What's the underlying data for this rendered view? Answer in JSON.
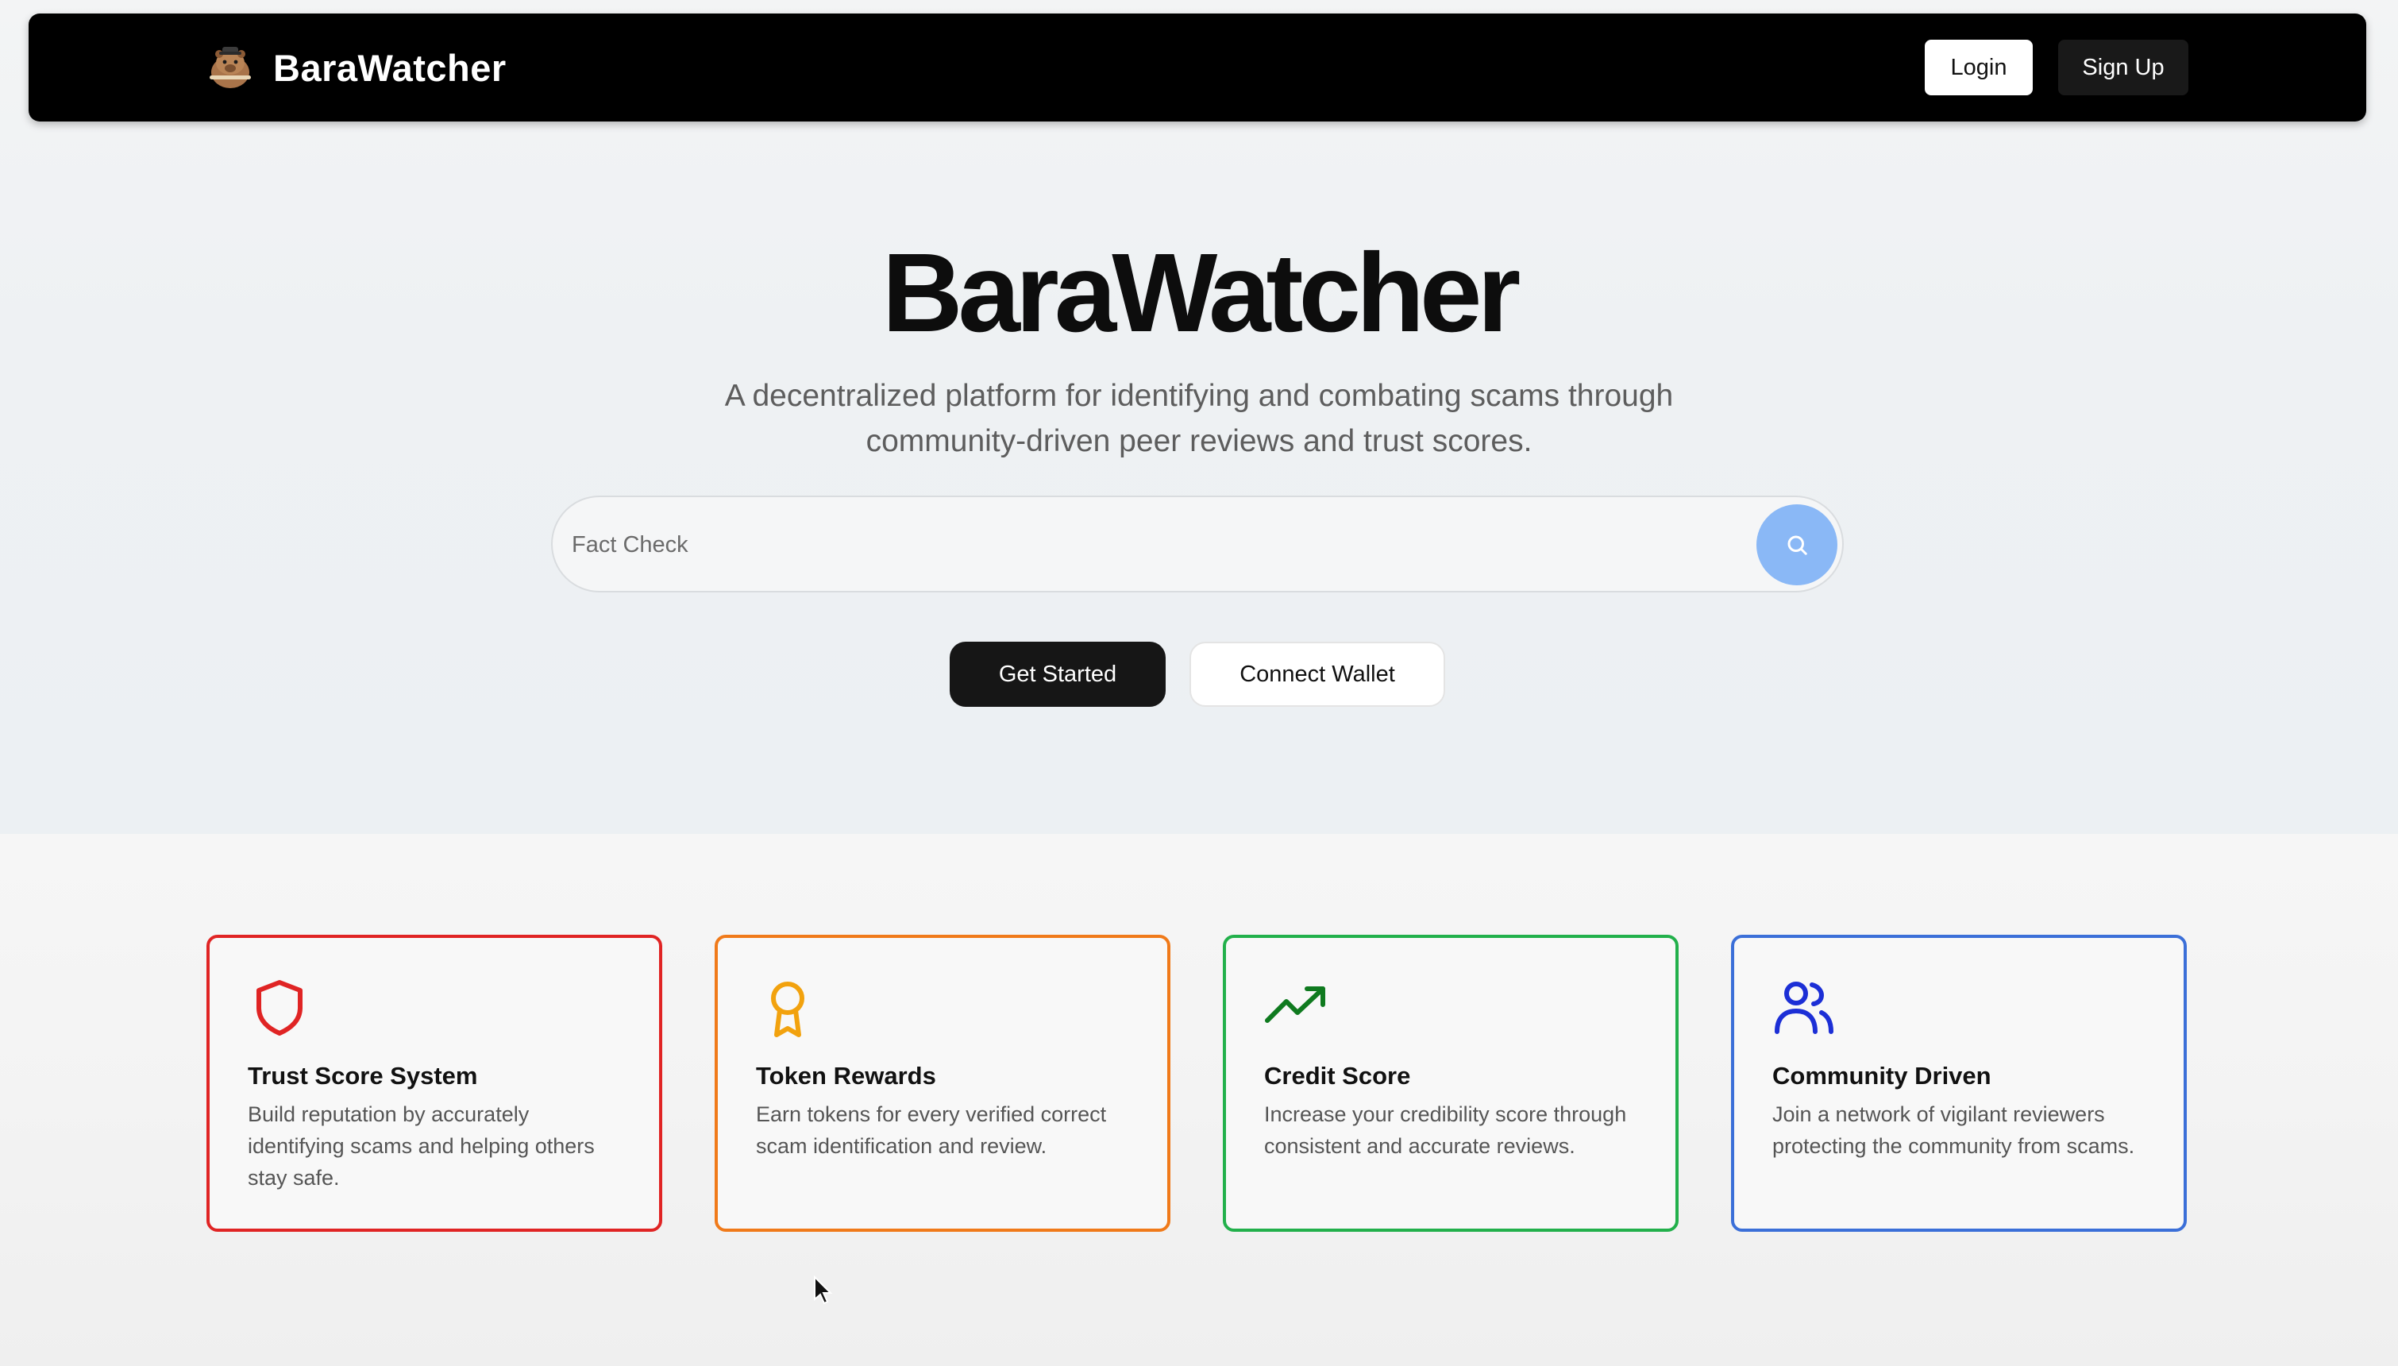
{
  "navbar": {
    "brand_name": "BaraWatcher",
    "login_label": "Login",
    "signup_label": "Sign Up"
  },
  "hero": {
    "title": "BaraWatcher",
    "subtitle": "A decentralized platform for identifying and combating scams through community-driven peer reviews and trust scores.",
    "search_placeholder": "Fact Check",
    "get_started_label": "Get Started",
    "connect_wallet_label": "Connect Wallet"
  },
  "features": [
    {
      "title": "Trust Score System",
      "description": "Build reputation by accurately identifying scams and helping others stay safe.",
      "icon": "shield-icon",
      "color": "#e02424"
    },
    {
      "title": "Token Rewards",
      "description": "Earn tokens for every verified correct scam identification and review.",
      "icon": "award-icon",
      "color": "#f07a1a"
    },
    {
      "title": "Credit Score",
      "description": "Increase your credibility score through consistent and accurate reviews.",
      "icon": "trending-up-icon",
      "color": "#22b04b"
    },
    {
      "title": "Community Driven",
      "description": "Join a network of vigilant reviewers protecting the community from scams.",
      "icon": "users-icon",
      "color": "#3b6fd8"
    }
  ],
  "colors": {
    "navbar_bg": "#000000",
    "search_button": "#8ab8f6",
    "primary_button": "#161616"
  }
}
